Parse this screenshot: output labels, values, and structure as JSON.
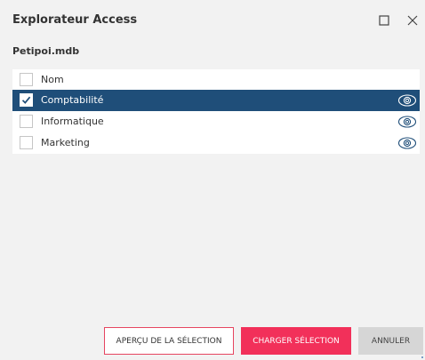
{
  "window": {
    "title": "Explorateur Access",
    "maximize_icon": "maximize-icon",
    "close_icon": "close-icon"
  },
  "file": {
    "name": "Petipoi.mdb"
  },
  "list": {
    "header": {
      "label": "Nom",
      "checked": false
    },
    "items": [
      {
        "label": "Comptabilité",
        "checked": true,
        "selected": true,
        "icon": "eye-icon"
      },
      {
        "label": "Informatique",
        "checked": false,
        "selected": false,
        "icon": "eye-icon"
      },
      {
        "label": "Marketing",
        "checked": false,
        "selected": false,
        "icon": "eye-icon"
      }
    ]
  },
  "buttons": {
    "preview": "APERÇU DE LA SÉLECTION",
    "load": "CHARGER SÉLECTION",
    "cancel": "ANNULER"
  },
  "colors": {
    "selected_row": "#1f4e79",
    "accent": "#f2305a",
    "background": "#f2f2f2"
  }
}
